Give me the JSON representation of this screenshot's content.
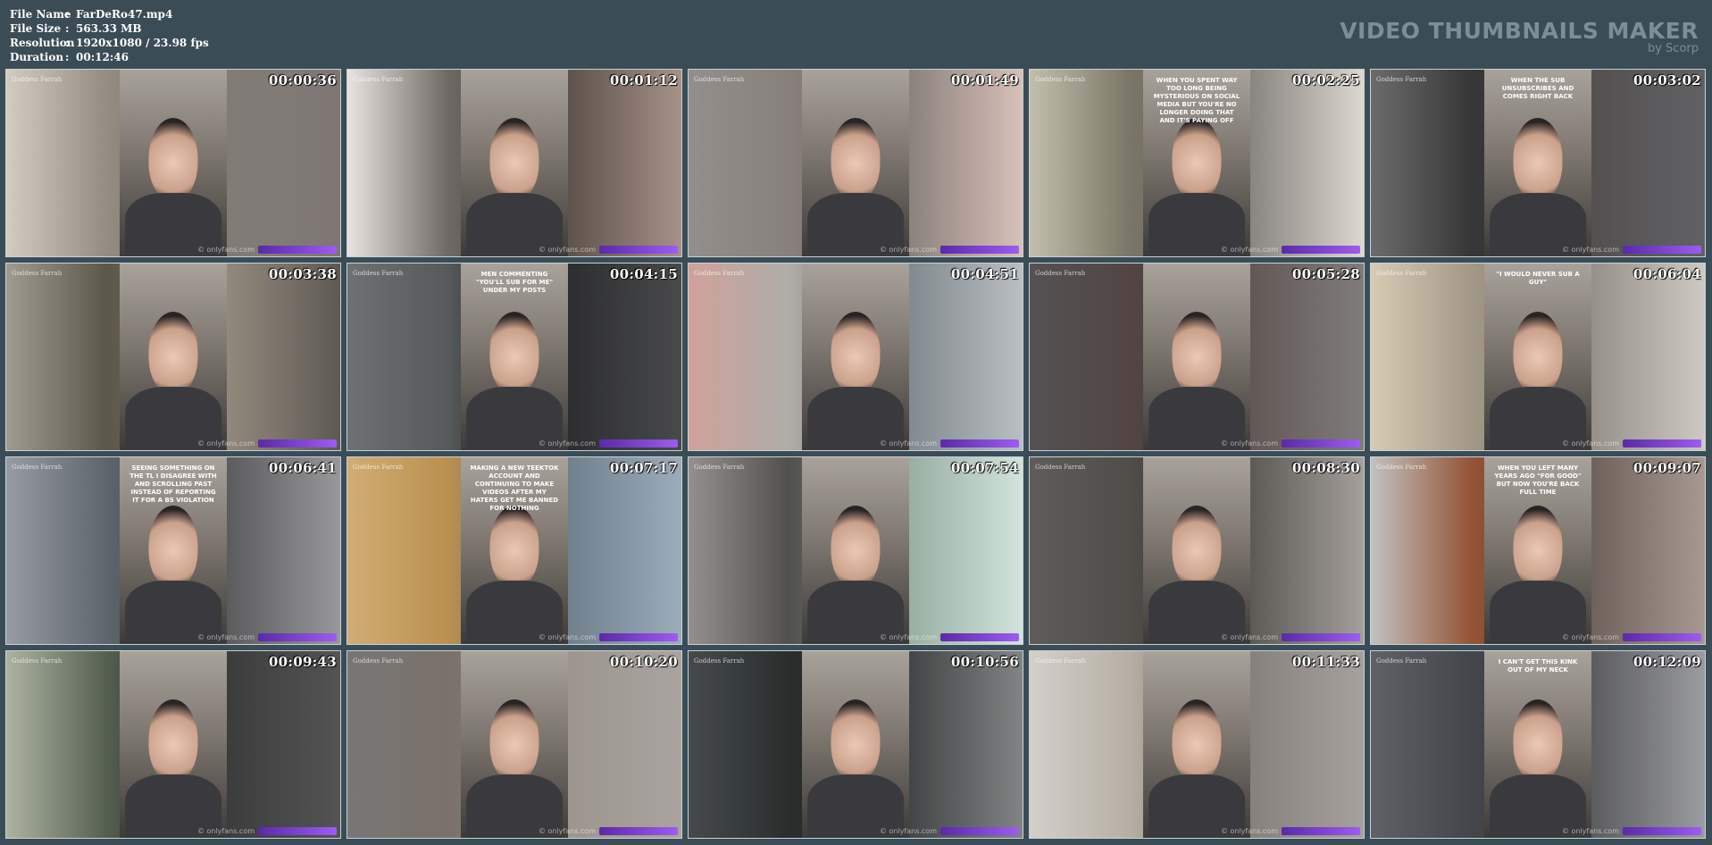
{
  "file_info": {
    "rows": [
      {
        "key": "File Name",
        "value": "FarDeRo47.mp4"
      },
      {
        "key": "File Size",
        "value": "563.33 MB"
      },
      {
        "key": "Resolution",
        "value": "1920x1080 / 23.98 fps"
      },
      {
        "key": "Duration",
        "value": "00:12:46"
      }
    ],
    "separator": ":"
  },
  "brand": {
    "title": "VIDEO THUMBNAILS MAKER",
    "subtitle": "by Scorp"
  },
  "thumbnails": [
    {
      "timestamp": "00:00:36",
      "caption": ""
    },
    {
      "timestamp": "00:01:12",
      "caption": ""
    },
    {
      "timestamp": "00:01:49",
      "caption": ""
    },
    {
      "timestamp": "00:02:25",
      "caption": "WHEN YOU SPENT WAY TOO LONG BEING MYSTERIOUS ON SOCIAL MEDIA BUT YOU'RE NO LONGER DOING THAT AND IT'S PAYING OFF"
    },
    {
      "timestamp": "00:03:02",
      "caption": "WHEN THE SUB UNSUBSCRIBES AND COMES RIGHT BACK"
    },
    {
      "timestamp": "00:03:38",
      "caption": ""
    },
    {
      "timestamp": "00:04:15",
      "caption": "MEN COMMENTING \"YOU'LL SUB FOR ME\" UNDER MY POSTS"
    },
    {
      "timestamp": "00:04:51",
      "caption": ""
    },
    {
      "timestamp": "00:05:28",
      "caption": ""
    },
    {
      "timestamp": "00:06:04",
      "caption": "\"I WOULD NEVER SUB A GUY\""
    },
    {
      "timestamp": "00:06:41",
      "caption": "SEEING SOMETHING ON THE TL I DISAGREE WITH AND SCROLLING PAST INSTEAD OF REPORTING IT FOR A BS VIOLATION"
    },
    {
      "timestamp": "00:07:17",
      "caption": "MAKING A NEW TEEKTOK ACCOUNT AND CONTINUING TO MAKE VIDEOS AFTER MY HATERS GET ME BANNED FOR NOTHING"
    },
    {
      "timestamp": "00:07:54",
      "caption": ""
    },
    {
      "timestamp": "00:08:30",
      "caption": ""
    },
    {
      "timestamp": "00:09:07",
      "caption": "WHEN YOU LEFT MANY YEARS AGO \"FOR GOOD\" BUT NOW YOU'RE BACK FULL TIME"
    },
    {
      "timestamp": "00:09:43",
      "caption": ""
    },
    {
      "timestamp": "00:10:20",
      "caption": ""
    },
    {
      "timestamp": "00:10:56",
      "caption": ""
    },
    {
      "timestamp": "00:11:33",
      "caption": ""
    },
    {
      "timestamp": "00:12:09",
      "caption": "I CAN'T GET THIS KINK OUT OF MY NECK"
    }
  ],
  "watermark": {
    "corner": "Goddess Farrah",
    "bottom": "© onlyfans.com"
  },
  "colors": {
    "background": "#3a4c56",
    "brand_text": "#7c8e98",
    "banner": "#7c3fd6"
  }
}
